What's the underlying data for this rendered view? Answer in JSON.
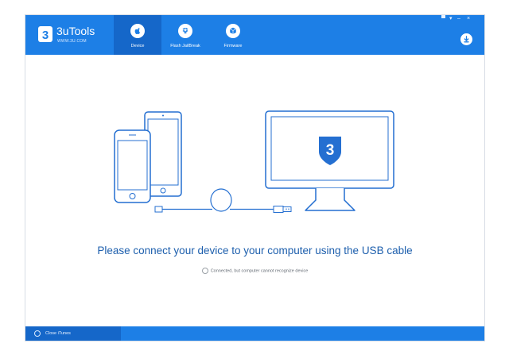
{
  "app": {
    "brand_mark": "3",
    "title": "3uTools",
    "url": "WWW.3U.COM"
  },
  "tabs": [
    {
      "label": "Device",
      "icon": "apple-icon",
      "active": true
    },
    {
      "label": "Flash JailBreak",
      "icon": "dropbox-icon",
      "active": false
    },
    {
      "label": "Firmware",
      "icon": "box-icon",
      "active": false
    }
  ],
  "window_controls": [
    "▀",
    "▾",
    "–",
    "×"
  ],
  "main": {
    "title": "Please connect your device to your computer using the USB cable",
    "sub_message": "Connected, but computer cannot recognize device",
    "monitor_mark": "3"
  },
  "statusbar": {
    "close_itunes_label": "Close iTunes"
  },
  "colors": {
    "brand_blue": "#1d7fe6",
    "active_tab": "#1567c9",
    "title_text": "#1d5fad",
    "illustration_stroke": "#246fd1"
  }
}
